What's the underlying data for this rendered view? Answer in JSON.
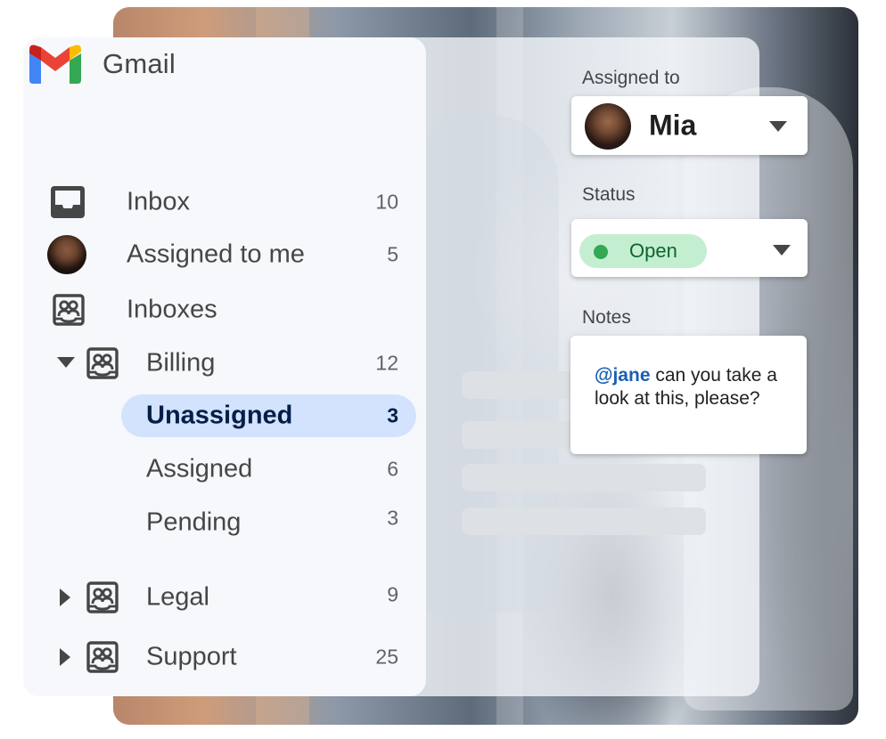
{
  "app": {
    "brand": "Gmail"
  },
  "sidebar": {
    "items": [
      {
        "label": "Inbox",
        "count": "10",
        "icon": "inbox-icon"
      },
      {
        "label": "Assigned to me",
        "count": "5",
        "icon": "avatar"
      },
      {
        "label": "Inboxes",
        "count": "",
        "icon": "shared-inbox-icon"
      },
      {
        "label": "Billing",
        "count": "12",
        "icon": "shared-inbox-icon",
        "expanded": true
      },
      {
        "label": "Unassigned",
        "count": "3",
        "active": true
      },
      {
        "label": "Assigned",
        "count": "6"
      },
      {
        "label": "Pending",
        "count": "3"
      },
      {
        "label": "Legal",
        "count": "9",
        "icon": "shared-inbox-icon",
        "expanded": false
      },
      {
        "label": "Support",
        "count": "25",
        "icon": "shared-inbox-icon",
        "expanded": false
      }
    ]
  },
  "details": {
    "assigned_label": "Assigned to",
    "assignee": "Mia",
    "status_label": "Status",
    "status_value": "Open",
    "notes_label": "Notes",
    "note_mention": "@jane",
    "note_text": " can you take a look at this, please?"
  },
  "colors": {
    "active_pill": "#d3e3fd",
    "status_chip": "#c4eed0",
    "status_dot": "#34a853",
    "mention": "#1a5fb4"
  }
}
